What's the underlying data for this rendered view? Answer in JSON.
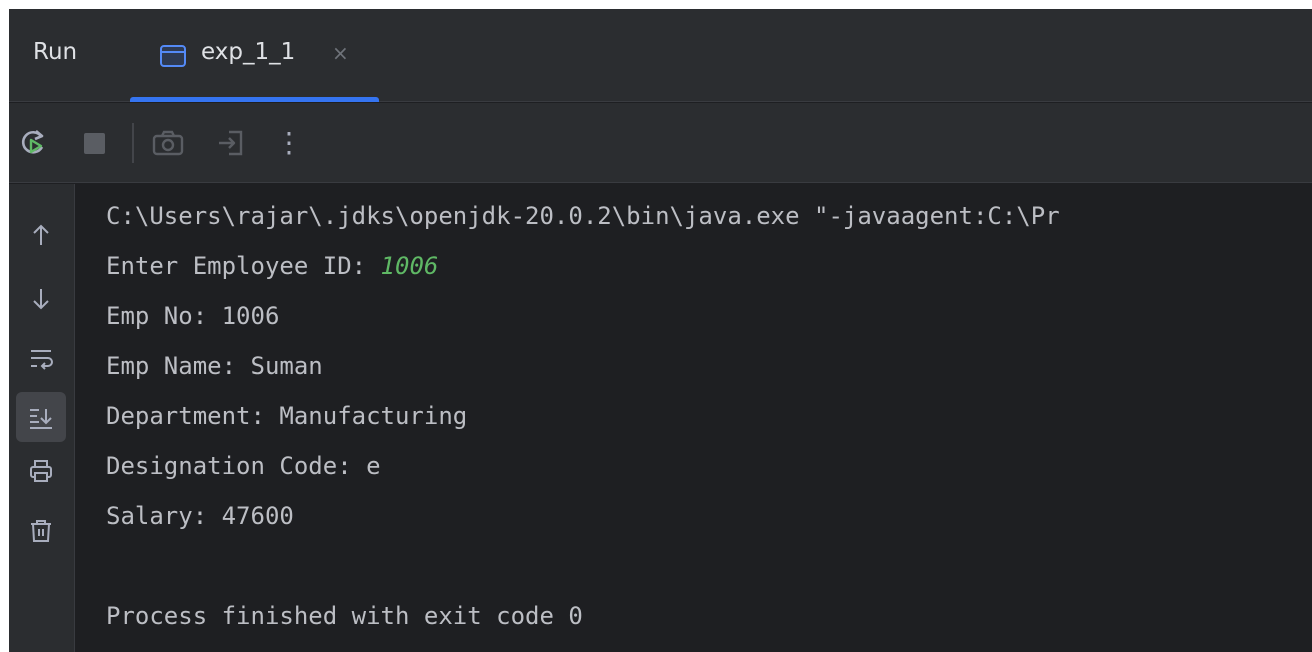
{
  "header": {
    "run_label": "Run",
    "tab": {
      "label": "exp_1_1",
      "close": "×",
      "icon": "console-tab-icon"
    }
  },
  "toolbar": {
    "buttons": [
      "rerun-icon",
      "stop-icon",
      "screenshot-icon",
      "exit-icon",
      "more-icon"
    ],
    "more_label": "⋮"
  },
  "gutter": {
    "buttons": [
      "up-arrow-icon",
      "down-arrow-icon",
      "soft-wrap-icon",
      "scroll-to-end-icon",
      "print-icon",
      "trash-icon"
    ],
    "up": "↑",
    "down": "↓"
  },
  "console": {
    "command_line": "C:\\Users\\rajar\\.jdks\\openjdk-20.0.2\\bin\\java.exe \"-javaagent:C:\\Pr",
    "prompt": "Enter Employee ID: ",
    "user_input": "1006",
    "emp_no": "Emp No: 1006",
    "emp_name": "Emp Name: Suman",
    "department": "Department: Manufacturing",
    "designation": "Designation Code: e",
    "salary": "Salary: 47600",
    "exit_message": "Process finished with exit code 0"
  },
  "colors": {
    "background": "#1e1f22",
    "panel": "#2b2d30",
    "accent": "#3574f0",
    "text": "#bcbec4",
    "input_text": "#5fb865"
  }
}
